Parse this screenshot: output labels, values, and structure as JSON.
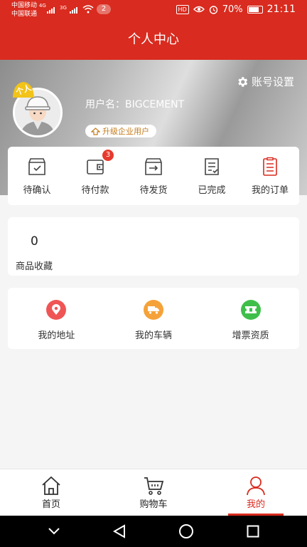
{
  "status_bar": {
    "carrier1": "中国移动",
    "carrier2": "中国联通",
    "net1": "4G",
    "net2": "3G",
    "notification_count": "2",
    "hd": "HD",
    "battery": "70%",
    "time": "21:11"
  },
  "header": {
    "title": "个人中心"
  },
  "profile": {
    "role_tag": "个人",
    "settings_label": "账号设置",
    "username": "用户名：BIGCEMENT",
    "upgrade_label": "升级企业用户"
  },
  "orders": {
    "items": [
      {
        "label": "待确认",
        "icon": "box-check-icon"
      },
      {
        "label": "待付款",
        "icon": "wallet-icon",
        "badge": "3"
      },
      {
        "label": "待发货",
        "icon": "box-arrow-icon"
      },
      {
        "label": "已完成",
        "icon": "document-check-icon"
      },
      {
        "label": "我的订单",
        "icon": "order-list-icon"
      }
    ]
  },
  "favorites": {
    "count": "0",
    "label": "商品收藏"
  },
  "services": {
    "items": [
      {
        "label": "我的地址",
        "icon": "location-icon",
        "color": "#f05555"
      },
      {
        "label": "我的车辆",
        "icon": "truck-icon",
        "color": "#f5a23a"
      },
      {
        "label": "增票资质",
        "icon": "ticket-icon",
        "color": "#3fbf4a"
      }
    ]
  },
  "tabbar": {
    "items": [
      {
        "label": "首页",
        "icon": "home-icon"
      },
      {
        "label": "购物车",
        "icon": "cart-icon"
      },
      {
        "label": "我的",
        "icon": "user-icon",
        "active": true
      }
    ]
  },
  "colors": {
    "brand": "#d92b1f",
    "badge": "#e63a2e",
    "upgrade_text": "#c37a1a"
  }
}
